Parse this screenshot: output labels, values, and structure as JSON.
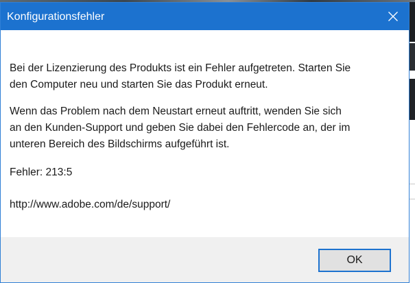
{
  "dialog": {
    "title": "Konfigurationsfehler",
    "close_icon": "close-icon",
    "message_paragraph_1_line_1": "Bei der Lizenzierung des Produkts ist ein Fehler aufgetreten. Starten Sie",
    "message_paragraph_1_line_2": "den Computer neu und starten Sie das Produkt erneut.",
    "message_paragraph_2_line_1": "Wenn das Problem nach dem Neustart erneut auftritt, wenden Sie sich",
    "message_paragraph_2_line_2": "an den Kunden-Support und geben Sie dabei den Fehlercode an, der im",
    "message_paragraph_2_line_3": "unteren Bereich des Bildschirms aufgeführt ist.",
    "error_code": "Fehler: 213:5",
    "support_url": "http://www.adobe.com/de/support/",
    "ok_label": "OK"
  },
  "colors": {
    "titlebar": "#1c72cf",
    "footer": "#f0f0f0",
    "button_face": "#e1e1e1",
    "button_focus_border": "#1c72cf"
  }
}
